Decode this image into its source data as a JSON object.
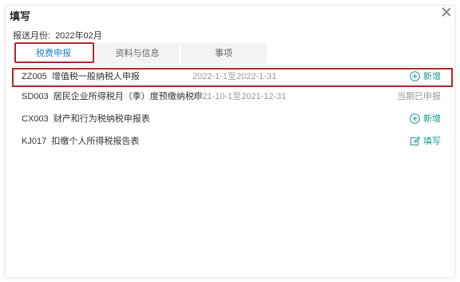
{
  "dialog": {
    "title": "填写"
  },
  "report": {
    "label": "报送月份:",
    "month": "2022年02月"
  },
  "tabs": [
    {
      "label": "税费申报"
    },
    {
      "label": "资料与信息"
    },
    {
      "label": "事项"
    }
  ],
  "rows": [
    {
      "code": "ZZ005",
      "name": "增值税一般纳税人申报",
      "period": "2022-1-1至2022-1-31",
      "action": "新增",
      "action_icon": "plus-circle-icon"
    },
    {
      "code": "SD003",
      "name": "居民企业所得税月（季）度预缴纳税申...",
      "period": "2021-10-1至2021-12-31",
      "action": "当期已申报"
    },
    {
      "code": "CX003",
      "name": "财产和行为税纳税申报表",
      "period": "",
      "action": "新增",
      "action_icon": "plus-circle-icon"
    },
    {
      "code": "KJ017",
      "name": "扣缴个人所得税报告表",
      "period": "",
      "action": "填写",
      "action_icon": "edit-icon"
    }
  ],
  "colors": {
    "accent": "#1a7fc6",
    "action": "#1a9a8c",
    "highlight": "#b3262b"
  }
}
